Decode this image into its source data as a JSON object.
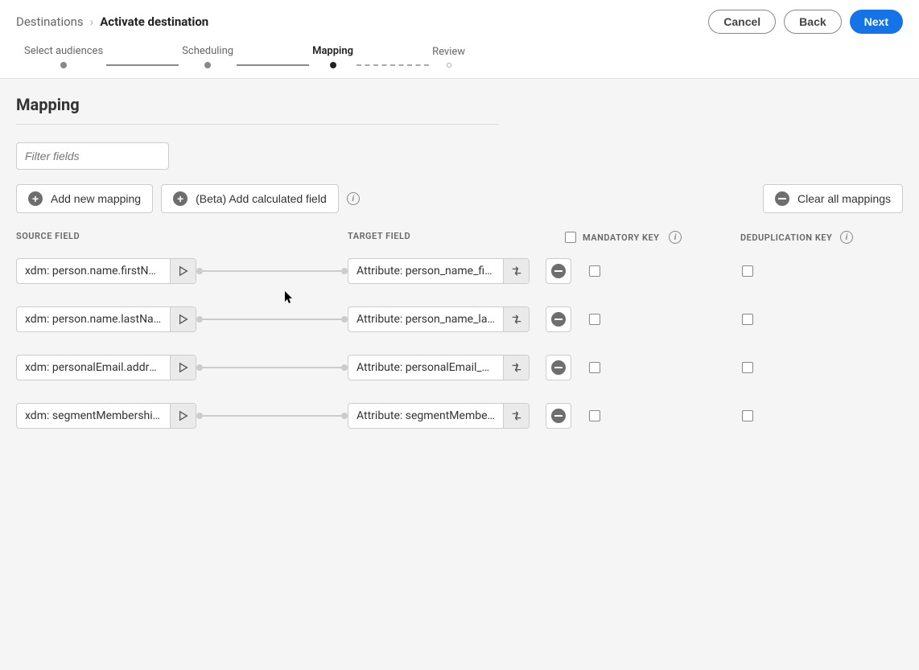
{
  "breadcrumb": {
    "root": "Destinations",
    "current": "Activate destination"
  },
  "actions": {
    "cancel": "Cancel",
    "back": "Back",
    "next": "Next"
  },
  "steps": [
    {
      "label": "Select audiences",
      "state": "done"
    },
    {
      "label": "Scheduling",
      "state": "done"
    },
    {
      "label": "Mapping",
      "state": "active"
    },
    {
      "label": "Review",
      "state": "pending"
    }
  ],
  "page": {
    "title": "Mapping",
    "filter_placeholder": "Filter fields"
  },
  "toolbar": {
    "add_new_mapping": "Add new mapping",
    "add_calculated_field": "(Beta) Add calculated field",
    "clear_all": "Clear all mappings"
  },
  "columns": {
    "source": "SOURCE FIELD",
    "target": "TARGET FIELD",
    "mandatory": "MANDATORY KEY",
    "dedup": "DEDUPLICATION KEY"
  },
  "mappings": [
    {
      "source": "xdm: person.name.firstName",
      "target": "Attribute: person_name_fir…"
    },
    {
      "source": "xdm: person.name.lastName",
      "target": "Attribute: person_name_la…"
    },
    {
      "source": "xdm: personalEmail.address",
      "target": "Attribute: personalEmail_a…"
    },
    {
      "source": "xdm: segmentMembership.…",
      "target": "Attribute: segmentMember…"
    }
  ]
}
